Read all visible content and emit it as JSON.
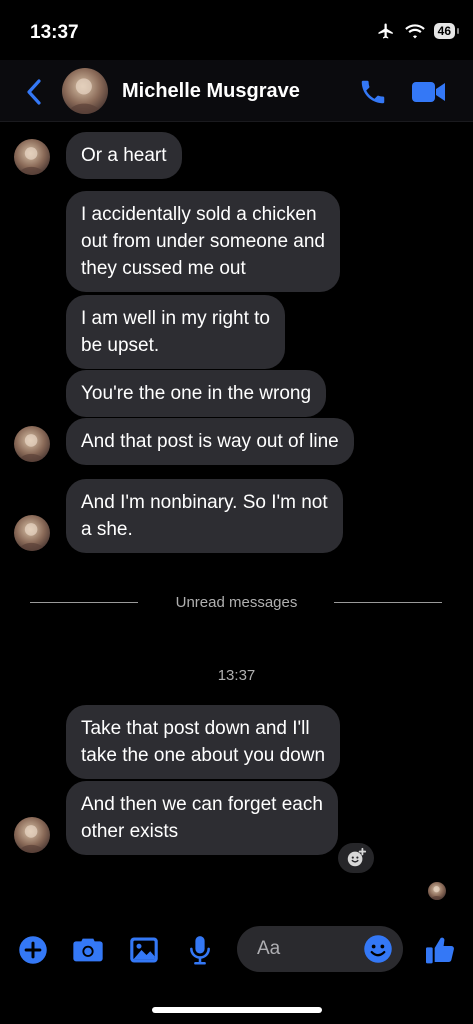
{
  "status_bar": {
    "time": "13:37",
    "battery": "46"
  },
  "header": {
    "contact_name": "Michelle Musgrave"
  },
  "messages": [
    {
      "lines": [
        "Or a heart"
      ]
    },
    {
      "lines": [
        "I accidentally sold a chicken",
        "out from under someone and",
        "they cussed me out"
      ]
    },
    {
      "lines": [
        "I am well in my right to",
        "be upset."
      ]
    },
    {
      "lines": [
        "You're the one in the wrong"
      ]
    },
    {
      "lines": [
        "And that post is way out of line"
      ]
    },
    {
      "lines": [
        "And I'm nonbinary. So I'm not",
        "a she."
      ]
    },
    {
      "lines": [
        "Take that post down and I'll",
        "take the one about you down"
      ]
    },
    {
      "lines": [
        "And then we can forget each",
        "other exists"
      ]
    }
  ],
  "unread_label": "Unread messages",
  "timestamp": "13:37",
  "composer": {
    "placeholder": "Aa"
  },
  "colors": {
    "accent": "#3478f6",
    "bubble": "#2d2d32",
    "background": "#000000"
  }
}
